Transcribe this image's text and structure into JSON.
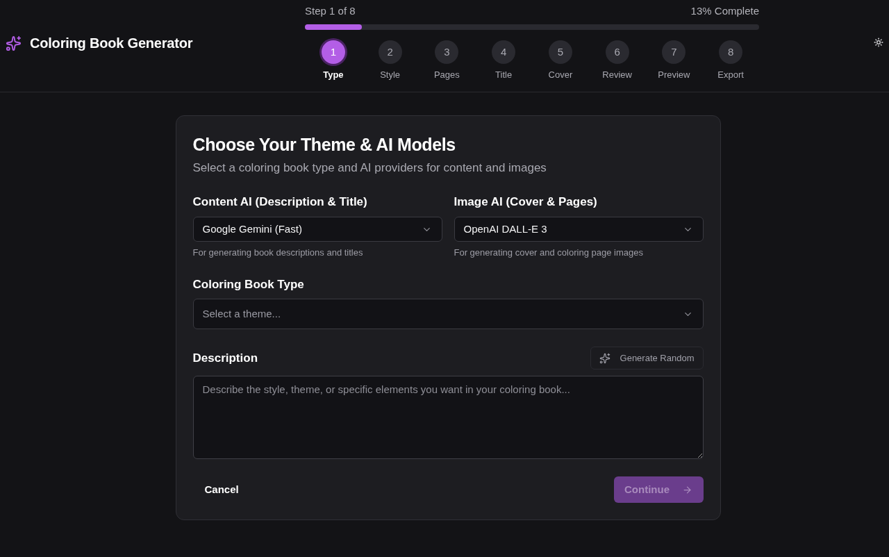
{
  "app": {
    "title": "Coloring Book Generator"
  },
  "progress": {
    "step_text": "Step 1 of 8",
    "complete_text": "13% Complete",
    "level": 0.125
  },
  "steps": [
    {
      "number": "1",
      "label": "Type",
      "selected": true
    },
    {
      "number": "2",
      "label": "Style",
      "selected": false
    },
    {
      "number": "3",
      "label": "Pages",
      "selected": false
    },
    {
      "number": "4",
      "label": "Title",
      "selected": false
    },
    {
      "number": "5",
      "label": "Cover",
      "selected": false
    },
    {
      "number": "6",
      "label": "Review",
      "selected": false
    },
    {
      "number": "7",
      "label": "Preview",
      "selected": false
    },
    {
      "number": "8",
      "label": "Export",
      "selected": false
    }
  ],
  "card": {
    "title": "Choose Your Theme & AI Models",
    "subtitle": "Select a coloring book type and AI providers for content and images",
    "model_selects": [
      {
        "label": "Content AI (Description & Title)",
        "value": "Google Gemini (Fast)",
        "hint": "For generating book descriptions and titles"
      },
      {
        "label": "Image AI (Cover & Pages)",
        "value": "OpenAI DALL-E 3",
        "hint": "For generating cover and coloring page images"
      }
    ],
    "type_select": {
      "label": "Coloring Book Type",
      "placeholder": "Select a theme..."
    },
    "description": {
      "label": "Description",
      "generate_button": "Generate Random",
      "placeholder": "Describe the style, theme, or specific elements you want in your coloring book..."
    },
    "actions": {
      "cancel": "Cancel",
      "continue": {
        "label": "Continue",
        "disabled": true
      }
    }
  }
}
